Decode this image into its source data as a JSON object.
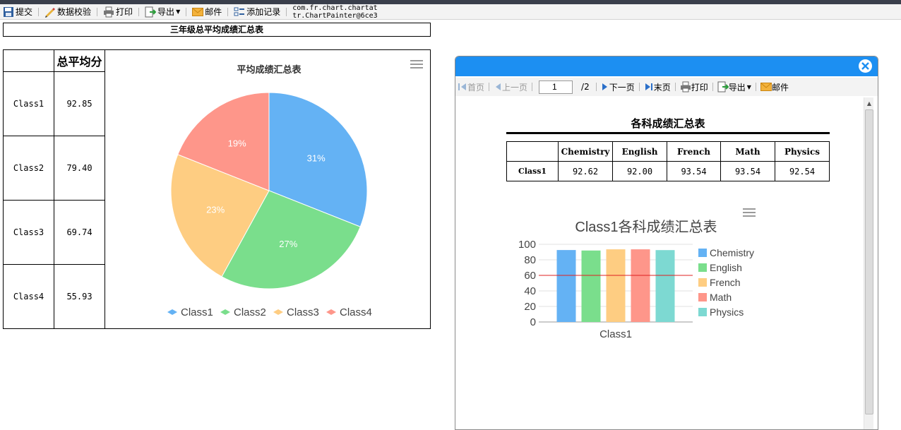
{
  "toolbar": {
    "items": [
      {
        "label": "提交",
        "icon": "save-icon"
      },
      {
        "label": "数据校验",
        "icon": "pencil-icon"
      },
      {
        "label": "打印",
        "icon": "printer-icon"
      },
      {
        "label": "导出",
        "icon": "export-icon"
      },
      {
        "label": "邮件",
        "icon": "mail-icon"
      },
      {
        "label": "添加记录",
        "icon": "add-record-icon"
      }
    ],
    "debug_text_line1": "com.fr.chart.chartat",
    "debug_text_line2": "tr.ChartPainter@6ce3"
  },
  "report": {
    "title": "三年级总平均成绩汇总表",
    "header_value": "总平均分",
    "rows": [
      {
        "class": "Class1",
        "value": "92.85"
      },
      {
        "class": "Class2",
        "value": "79.40"
      },
      {
        "class": "Class3",
        "value": "69.74"
      },
      {
        "class": "Class4",
        "value": "55.93"
      }
    ]
  },
  "chart_data": [
    {
      "type": "pie",
      "title": "平均成绩汇总表",
      "categories": [
        "Class1",
        "Class2",
        "Class3",
        "Class4"
      ],
      "values": [
        31,
        27,
        23,
        19
      ],
      "labels": [
        "31%",
        "27%",
        "23%",
        "19%"
      ],
      "colors": [
        "#64b2f4",
        "#7ade8c",
        "#fecd82",
        "#fe968a"
      ],
      "legend_position": "bottom"
    },
    {
      "type": "bar",
      "title": "Class1各科成绩汇总表",
      "categories": [
        "Class1"
      ],
      "series": [
        {
          "name": "Chemistry",
          "values": [
            92.62
          ],
          "color": "#64b2f4"
        },
        {
          "name": "English",
          "values": [
            92.0
          ],
          "color": "#7ade8c"
        },
        {
          "name": "French",
          "values": [
            93.54
          ],
          "color": "#fecd82"
        },
        {
          "name": "Math",
          "values": [
            93.54
          ],
          "color": "#fe968a"
        },
        {
          "name": "Physics",
          "values": [
            92.54
          ],
          "color": "#7dd9d2"
        }
      ],
      "ylim": [
        0,
        100
      ],
      "yticks": [
        "100",
        "80",
        "60",
        "40",
        "20",
        "0"
      ],
      "reference_line": {
        "value": 60,
        "color": "#e02020"
      },
      "legend_position": "right",
      "grid": true
    }
  ],
  "dialog": {
    "accent": "#1c8ff2",
    "toolbar": {
      "first": "首页",
      "prev": "上一页",
      "page_value": "1",
      "page_total": "/2",
      "next": "下一页",
      "last": "末页",
      "print": "打印",
      "export": "导出",
      "mail": "邮件"
    },
    "table": {
      "title": "各科成绩汇总表",
      "columns": [
        "Chemistry",
        "English",
        "French",
        "Math",
        "Physics"
      ],
      "row_label": "Class1",
      "row_values": [
        "92.62",
        "92.00",
        "93.54",
        "93.54",
        "92.54"
      ]
    }
  }
}
